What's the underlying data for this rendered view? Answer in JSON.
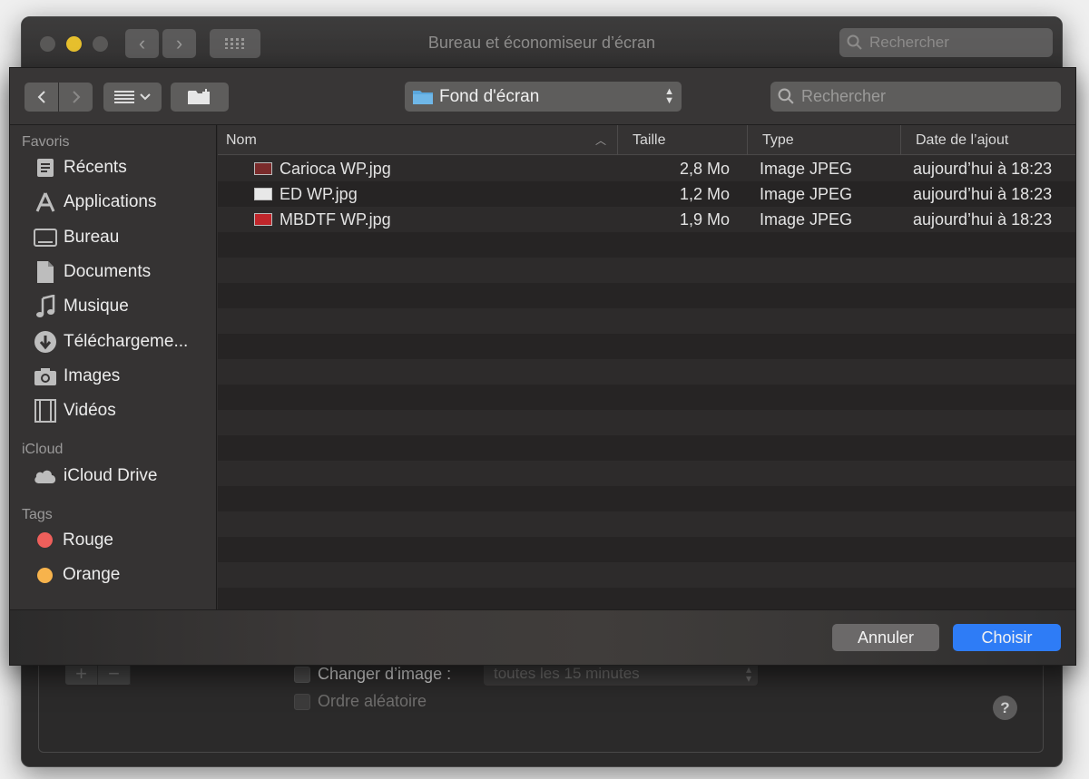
{
  "background_window": {
    "title": "Bureau et économiseur d’écran",
    "search_placeholder": "Rechercher",
    "change_image_label": "Changer d’image :",
    "interval_value": "toutes les 15 minutes",
    "random_order_label": "Ordre aléatoire",
    "help_label": "?",
    "plus_label": "+",
    "minus_label": "−"
  },
  "dialog": {
    "path_popup": "Fond d'écran",
    "search_placeholder": "Rechercher",
    "sidebar": {
      "favorites_title": "Favoris",
      "favorites": [
        {
          "label": "Récents",
          "icon": "clock-icon"
        },
        {
          "label": "Applications",
          "icon": "applications-icon"
        },
        {
          "label": "Bureau",
          "icon": "desktop-icon"
        },
        {
          "label": "Documents",
          "icon": "document-icon"
        },
        {
          "label": "Musique",
          "icon": "music-icon"
        },
        {
          "label": "Téléchargeme...",
          "icon": "download-icon"
        },
        {
          "label": "Images",
          "icon": "camera-icon"
        },
        {
          "label": "Vidéos",
          "icon": "film-icon"
        }
      ],
      "icloud_title": "iCloud",
      "icloud": [
        {
          "label": "iCloud Drive",
          "icon": "cloud-icon"
        }
      ],
      "tags_title": "Tags",
      "tags": [
        {
          "label": "Rouge",
          "color": "#ee5f5b"
        },
        {
          "label": "Orange",
          "color": "#f7b34c"
        }
      ]
    },
    "columns": {
      "name": "Nom",
      "size": "Taille",
      "type": "Type",
      "date": "Date de l’ajout"
    },
    "files": [
      {
        "name": "Carioca WP.jpg",
        "size": "2,8 Mo",
        "type": "Image JPEG",
        "date": "aujourd’hui à 18:23",
        "thumb_color": "#7a2b2b"
      },
      {
        "name": "ED WP.jpg",
        "size": "1,2 Mo",
        "type": "Image JPEG",
        "date": "aujourd’hui à 18:23",
        "thumb_color": "#e8e8e8"
      },
      {
        "name": "MBDTF WP.jpg",
        "size": "1,9 Mo",
        "type": "Image JPEG",
        "date": "aujourd’hui à 18:23",
        "thumb_color": "#c0262b"
      }
    ],
    "buttons": {
      "cancel": "Annuler",
      "choose": "Choisir"
    }
  }
}
